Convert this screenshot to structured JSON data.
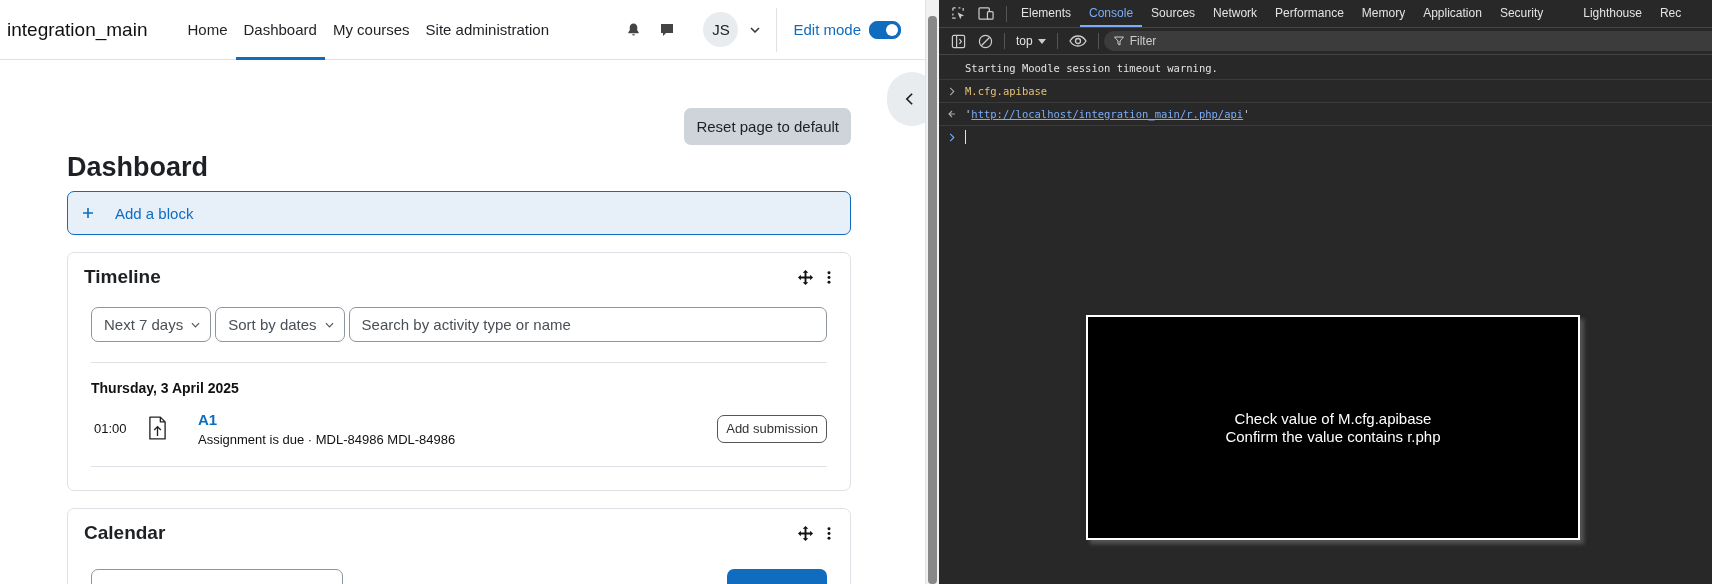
{
  "site": {
    "name": "integration_main"
  },
  "nav": [
    {
      "label": "Home",
      "selected": false
    },
    {
      "label": "Dashboard",
      "selected": true
    },
    {
      "label": "My courses",
      "selected": false
    },
    {
      "label": "Site administration",
      "selected": false
    }
  ],
  "user": {
    "initials": "JS"
  },
  "edit_mode": {
    "label": "Edit mode",
    "on": true
  },
  "reset_button": "Reset page to default",
  "page_title": "Dashboard",
  "add_block": "Add a block",
  "blocks": [
    {
      "kind": "timeline",
      "title": "Timeline",
      "filters": [
        "Next 7 days",
        "Sort by dates"
      ],
      "search": {
        "placeholder": "Search by activity type or name"
      },
      "date": "Thursday, 3 April 2025",
      "events": [
        {
          "time": "01:00",
          "name": "A1",
          "detail": "Assignment is due · MDL-84986 MDL-84986",
          "action": "Add submission"
        }
      ]
    },
    {
      "kind": "calendar",
      "title": "Calendar"
    }
  ],
  "devtools": {
    "tabs": [
      {
        "label": "Elements",
        "selected": false
      },
      {
        "label": "Console",
        "selected": true
      },
      {
        "label": "Sources",
        "selected": false
      },
      {
        "label": "Network",
        "selected": false
      },
      {
        "label": "Performance",
        "selected": false
      },
      {
        "label": "Memory",
        "selected": false
      },
      {
        "label": "Application",
        "selected": false
      },
      {
        "label": "Security",
        "selected": false
      },
      {
        "label": "Lighthouse",
        "selected": false
      },
      {
        "label": "Rec",
        "selected": false
      }
    ],
    "context": "top",
    "filter": {
      "placeholder": "Filter"
    },
    "console": [
      {
        "kind": "log",
        "text": "Starting Moodle session timeout warning."
      },
      {
        "kind": "input",
        "text": "M.cfg.apibase"
      },
      {
        "kind": "result",
        "prefix": "'",
        "url": "http://localhost/integration_main/r.php/api",
        "suffix": "'"
      },
      {
        "kind": "prompt"
      }
    ]
  },
  "caption": {
    "lines": [
      "Check value of M.cfg.apibase",
      "Confirm the value contains r.php"
    ]
  }
}
